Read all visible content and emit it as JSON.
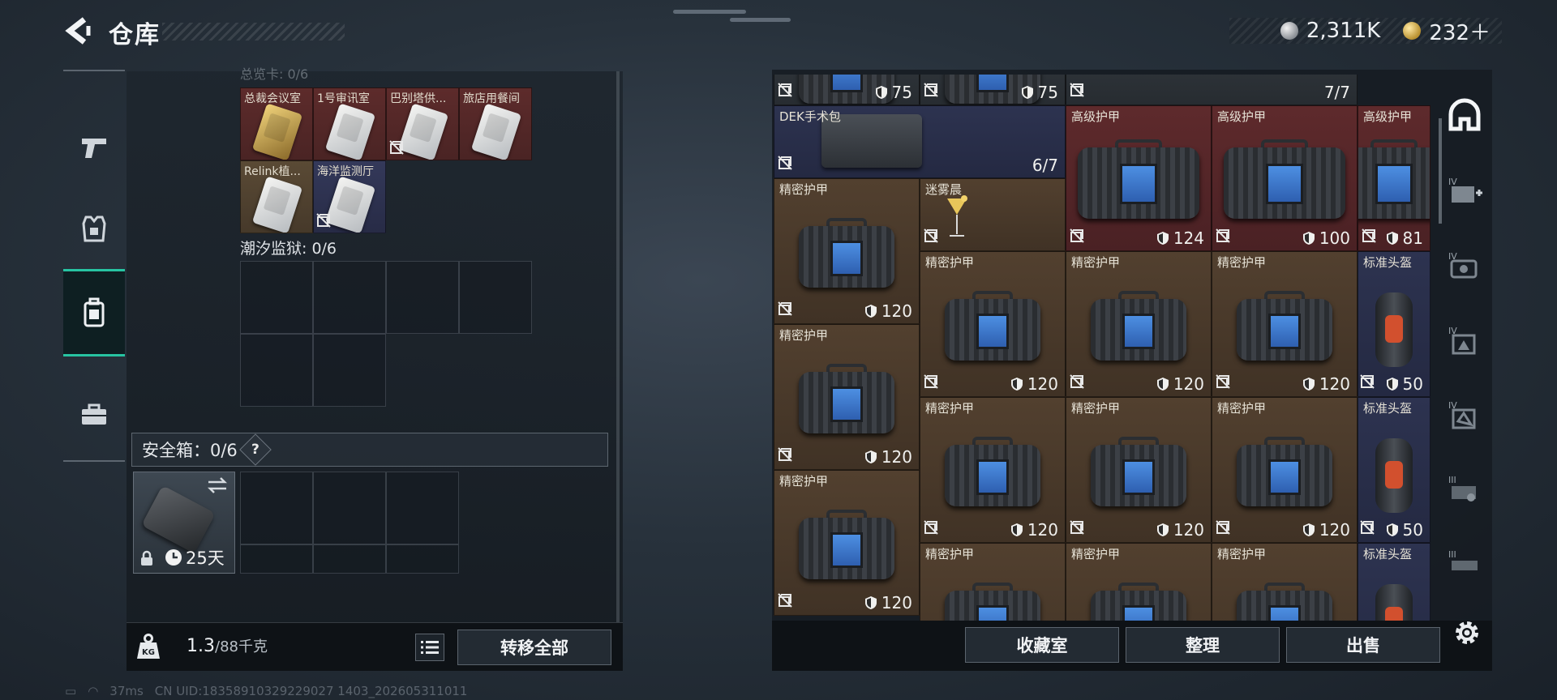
{
  "header": {
    "title": "仓库"
  },
  "currency": [
    {
      "icon": "silver-coin-icon",
      "value": "2,311K"
    },
    {
      "icon": "gold-coin-icon",
      "value": "232＋"
    }
  ],
  "left_tabs": [
    {
      "name": "weapon-tab",
      "icon": "pistol-icon"
    },
    {
      "name": "gear-tab",
      "icon": "vest-icon"
    },
    {
      "name": "backpack-tab",
      "icon": "backpack-icon",
      "active": true
    },
    {
      "name": "briefcase-tab",
      "icon": "briefcase-icon"
    }
  ],
  "keycards": [
    {
      "name": "总裁会议室",
      "color": "red",
      "card": "gold"
    },
    {
      "name": "1号审讯室",
      "color": "red",
      "card": "silver"
    },
    {
      "name": "巴别塔供...",
      "color": "red",
      "card": "silver",
      "flag": true
    },
    {
      "name": "旅店用餐间",
      "color": "red",
      "card": "silver"
    },
    {
      "name": "Relink植...",
      "color": "brown",
      "card": "silver"
    },
    {
      "name": "海洋监测厅",
      "color": "blue",
      "card": "silver",
      "flag": true
    }
  ],
  "prison_label": "潮汐监狱: 0/6",
  "safebox": {
    "label": "安全箱：0/6",
    "help": "?",
    "timer": "25天"
  },
  "weight": {
    "value": "1.3",
    "unit": "/88千克"
  },
  "transfer_all": "转移全部",
  "stash_items": [
    {
      "name": "",
      "value": "75",
      "color": "dark",
      "type": "armor"
    },
    {
      "name": "",
      "value": "75",
      "color": "dark",
      "type": "armor"
    },
    {
      "name": "",
      "value": "7/7",
      "color": "dark",
      "type": "case"
    },
    {
      "name": "DEK手术包",
      "value": "6/7",
      "color": "blue",
      "type": "surgery"
    },
    {
      "name": "高级护甲",
      "value": "124",
      "color": "red",
      "type": "armor"
    },
    {
      "name": "高级护甲",
      "value": "100",
      "color": "red",
      "type": "armor"
    },
    {
      "name": "高级护甲",
      "value": "81",
      "color": "red",
      "type": "armor"
    },
    {
      "name": "精密护甲",
      "value": "120",
      "color": "brown",
      "type": "armor"
    },
    {
      "name": "迷雾晨",
      "value": "",
      "color": "brown",
      "type": "cocktail"
    },
    {
      "name": "精密护甲",
      "value": "120",
      "color": "brown",
      "type": "armor"
    },
    {
      "name": "精密护甲",
      "value": "120",
      "color": "brown",
      "type": "armor"
    },
    {
      "name": "精密护甲",
      "value": "120",
      "color": "brown",
      "type": "armor"
    },
    {
      "name": "标准头盔",
      "value": "50",
      "color": "blue",
      "type": "helmet"
    },
    {
      "name": "精密护甲",
      "value": "120",
      "color": "brown",
      "type": "armor"
    },
    {
      "name": "精密护甲",
      "value": "120",
      "color": "brown",
      "type": "armor"
    },
    {
      "name": "精密护甲",
      "value": "120",
      "color": "brown",
      "type": "armor"
    },
    {
      "name": "精密护甲",
      "value": "120",
      "color": "brown",
      "type": "armor"
    },
    {
      "name": "标准头盔",
      "value": "50",
      "color": "blue",
      "type": "helmet"
    },
    {
      "name": "精密护甲",
      "value": "120",
      "color": "brown",
      "type": "armor"
    },
    {
      "name": "精密护甲",
      "value": "",
      "color": "brown",
      "type": "armor"
    },
    {
      "name": "精密护甲",
      "value": "",
      "color": "brown",
      "type": "armor"
    },
    {
      "name": "精密护甲",
      "value": "",
      "color": "brown",
      "type": "armor"
    },
    {
      "name": "标准头盔",
      "value": "",
      "color": "blue",
      "type": "helmet"
    }
  ],
  "actions": {
    "collection": "收藏室",
    "organize": "整理",
    "sell": "出售"
  },
  "right_categories": [
    {
      "name": "category-all",
      "icon": "home-icon",
      "active": true
    },
    {
      "name": "category-iv-medical",
      "icon": "medkit-icon",
      "tier": "IV"
    },
    {
      "name": "category-iv-cards",
      "icon": "keycard-icon",
      "tier": "IV"
    },
    {
      "name": "category-iv-armor",
      "icon": "armor-icon",
      "tier": "IV"
    },
    {
      "name": "category-iv-helmet",
      "icon": "helmet-icon",
      "tier": "IV"
    },
    {
      "name": "category-iii-weapon",
      "icon": "weapon-icon",
      "tier": "III"
    },
    {
      "name": "category-iii-ammo",
      "icon": "ammo-icon",
      "tier": "III"
    }
  ],
  "status": {
    "ping": "37ms",
    "uid": "CN UID:18358910329229027 1403_202605311011"
  },
  "colors": {
    "accent": "#27c4a2",
    "red_slot": "#5e2a2c",
    "brown_slot": "#52402f",
    "blue_slot": "#2d3350"
  }
}
